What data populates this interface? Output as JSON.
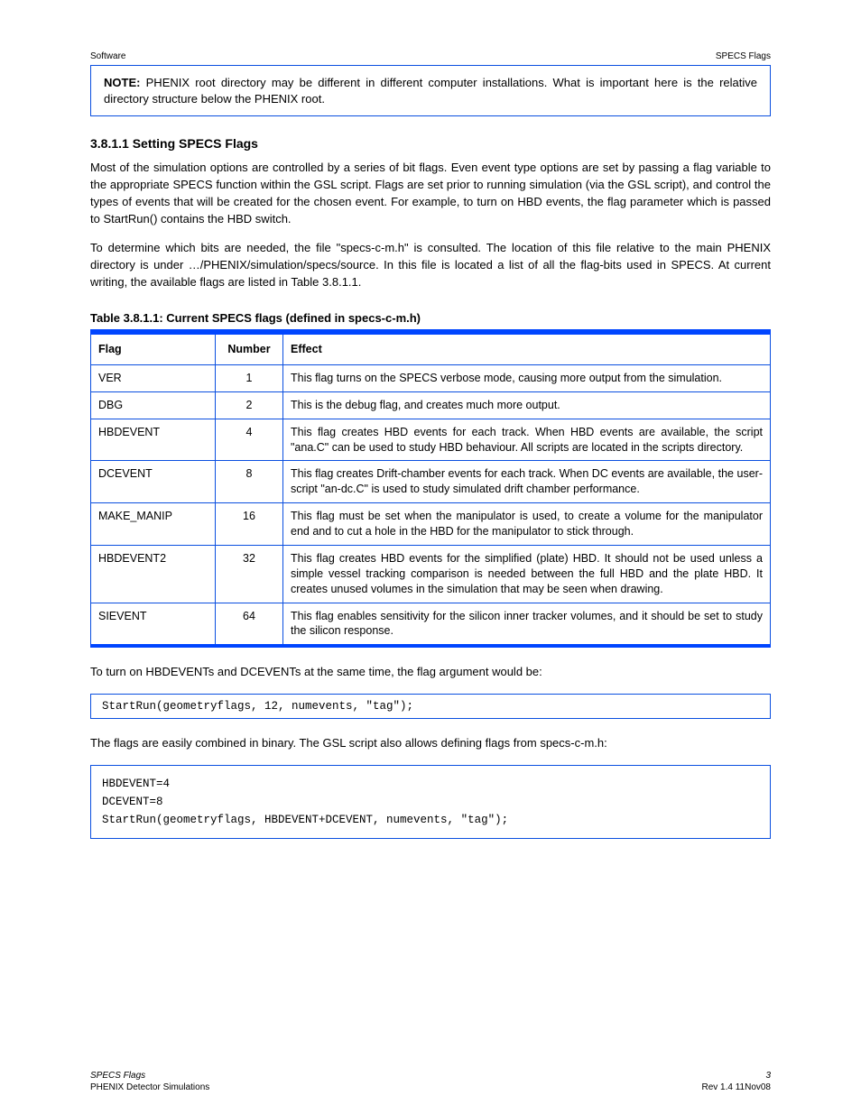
{
  "header": {
    "left": "Software",
    "right": "SPECS Flags"
  },
  "note1": {
    "label": "NOTE: ",
    "text": "PHENIX root directory may be different in different computer installations. What is important here is the relative directory structure below the PHENIX root."
  },
  "section_heading": "3.8.1.1   Setting SPECS Flags",
  "para1": "Most of the simulation options are controlled by a series of bit flags. Even event type options are set by passing a flag variable to the appropriate SPECS function within the GSL script. Flags are set prior to running simulation (via the GSL script), and control the types of events that will be created for the chosen event. For example, to turn on HBD events, the flag parameter which is passed to StartRun() contains the HBD switch.",
  "para2": "To determine which bits are needed, the file \"specs-c-m.h\" is consulted. The location of this file relative to the main PHENIX directory is under …/PHENIX/simulation/specs/source. In this file is located a list of all the flag-bits used in SPECS. At current writing, the available flags are listed in Table 3.8.1.1.",
  "table": {
    "title": "Table 3.8.1.1:   Current SPECS flags (defined in specs-c-m.h)",
    "headers": [
      "Flag",
      "Number",
      "Effect"
    ],
    "rows": [
      {
        "flag": "VER",
        "num": "1",
        "effect": "This flag turns on the SPECS verbose mode, causing more output from the simulation."
      },
      {
        "flag": "DBG",
        "num": "2",
        "effect": "This is the debug flag, and creates much more output."
      },
      {
        "flag": "HBDEVENT",
        "num": "4",
        "effect": "This flag creates HBD events for each track. When HBD events are available, the script \"ana.C\" can be used to study HBD behaviour. All scripts are located in the scripts directory."
      },
      {
        "flag": "DCEVENT",
        "num": "8",
        "effect": "This flag creates Drift-chamber events for each track. When DC events are available, the user-script \"an-dc.C\" is used to study simulated drift chamber performance."
      },
      {
        "flag": "MAKE_MANIP",
        "num": "16",
        "effect": "This flag must be set when the manipulator is used, to create a volume for the manipulator end and to cut a hole in the HBD for the manipulator to stick through."
      },
      {
        "flag": "HBDEVENT2",
        "num": "32",
        "effect": "This flag creates HBD events for the simplified (plate) HBD. It should not be used unless a simple vessel tracking comparison is needed between the full HBD and the plate HBD. It creates unused volumes in the simulation that may be seen when drawing."
      },
      {
        "flag": "SIEVENT",
        "num": "64",
        "effect": "This flag enables sensitivity for the silicon inner tracker volumes, and it should be set to study the silicon response."
      }
    ]
  },
  "para3": "To turn on HBDEVENTs and DCEVENTs at the same time, the flag argument would be:",
  "cmd1": "StartRun(geometryflags, 12, numevents, \"tag\");",
  "para4": "The flags are easily combined in binary. The GSL script also allows defining flags from specs-c-m.h:",
  "cmd2_lines": [
    "HBDEVENT=4",
    "DCEVENT=8",
    "StartRun(geometryflags, HBDEVENT+DCEVENT, numevents, \"tag\");"
  ],
  "footer": {
    "row1_left": "SPECS Flags",
    "row1_right": "3",
    "row2_left": "PHENIX Detector Simulations",
    "row2_right": "Rev 1.4   11Nov08"
  }
}
